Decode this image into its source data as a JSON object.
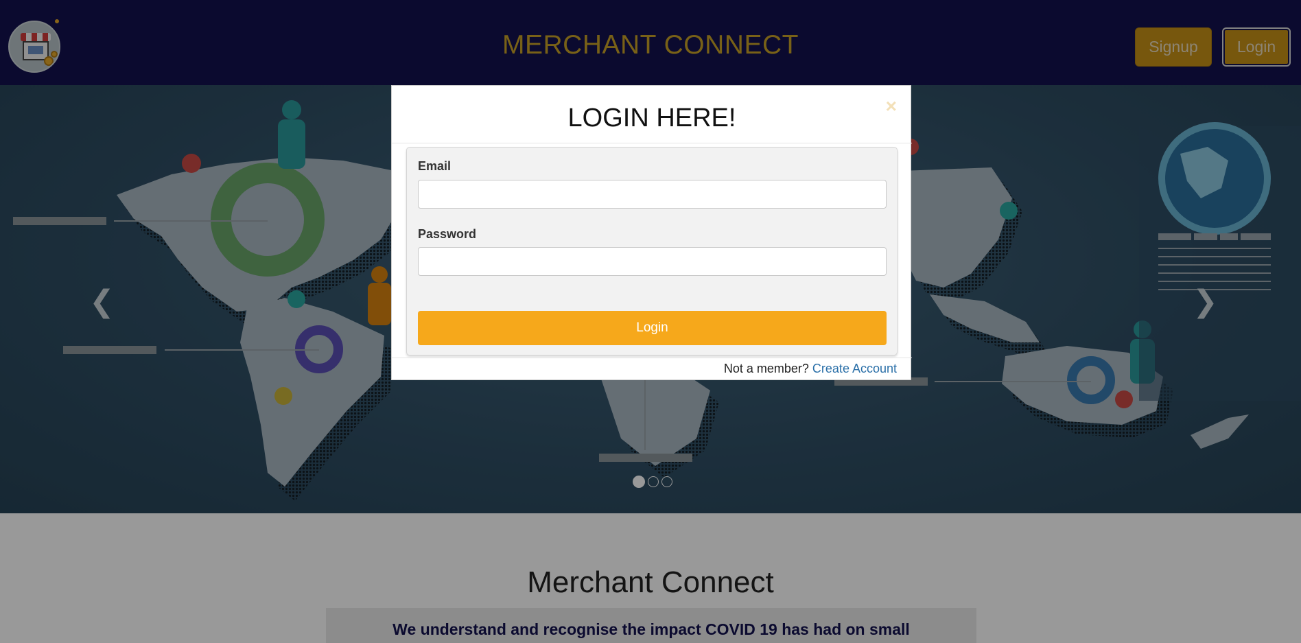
{
  "navbar": {
    "brand": "MERCHANT CONNECT",
    "signup_label": "Signup",
    "login_label": "Login",
    "logo_icon": "storefront-logo-icon"
  },
  "carousel": {
    "prev_icon": "chevron-left-icon",
    "next_icon": "chevron-right-icon",
    "prev_glyph": "❮",
    "next_glyph": "❯",
    "slide_count": 3,
    "active_slide": 1
  },
  "content": {
    "title": "Merchant Connect",
    "intro": "We understand and recognise the impact COVID 19 has had on small"
  },
  "modal": {
    "title": "LOGIN HERE!",
    "close_glyph": "×",
    "email_label": "Email",
    "password_label": "Password",
    "submit_label": "Login",
    "footer_text": "Not a member?",
    "footer_link": "Create Account"
  },
  "colors": {
    "navbar_bg": "#13124f",
    "brand_gold": "#c9a227",
    "nav_button": "#c79216",
    "submit_orange": "#f6a81b",
    "link_blue": "#2a6fa8"
  }
}
